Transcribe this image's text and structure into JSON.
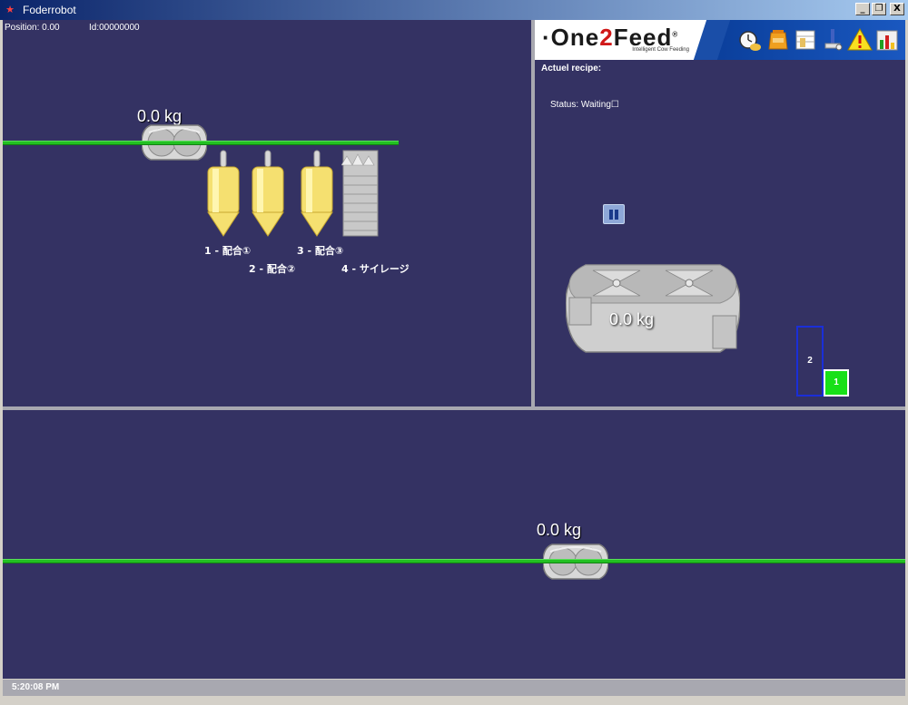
{
  "window": {
    "title": "Foderrobot",
    "minimize": "_",
    "restore": "❐",
    "close": "X"
  },
  "topLeft": {
    "position": "Position: 0.00",
    "id": "Id:00000000",
    "wagonWeight": "0.0 kg",
    "silos": [
      {
        "label": "1 - 配合①"
      },
      {
        "label": "2 - 配合②"
      },
      {
        "label": "3 - 配合③"
      },
      {
        "label": "4 - サイレージ"
      }
    ]
  },
  "topRight": {
    "logo": {
      "pre": "·One",
      "two": "2",
      "post": "Feed",
      "reg": "®",
      "tagline": "Intelligent Cow Feeding"
    },
    "toolbarIcons": [
      "feeding-clock-icon",
      "feed-bag-icon",
      "recipe-table-icon",
      "robot-arm-icon",
      "warning-icon",
      "statistics-chart-icon"
    ],
    "recipeTitle": "Actuel recipe:",
    "status": "Status: Waiting☐",
    "mixerWeight": "0.0 kg",
    "slot2": "2",
    "slot1": "1"
  },
  "bottom": {
    "wagonWeight": "0.0 kg"
  },
  "statusbar": {
    "clock": "5:20:08 PM"
  },
  "colors": {
    "background": "#343263",
    "rail": "#22c022",
    "active_slot": "#18e018",
    "slot_border": "#1a2ed8"
  }
}
